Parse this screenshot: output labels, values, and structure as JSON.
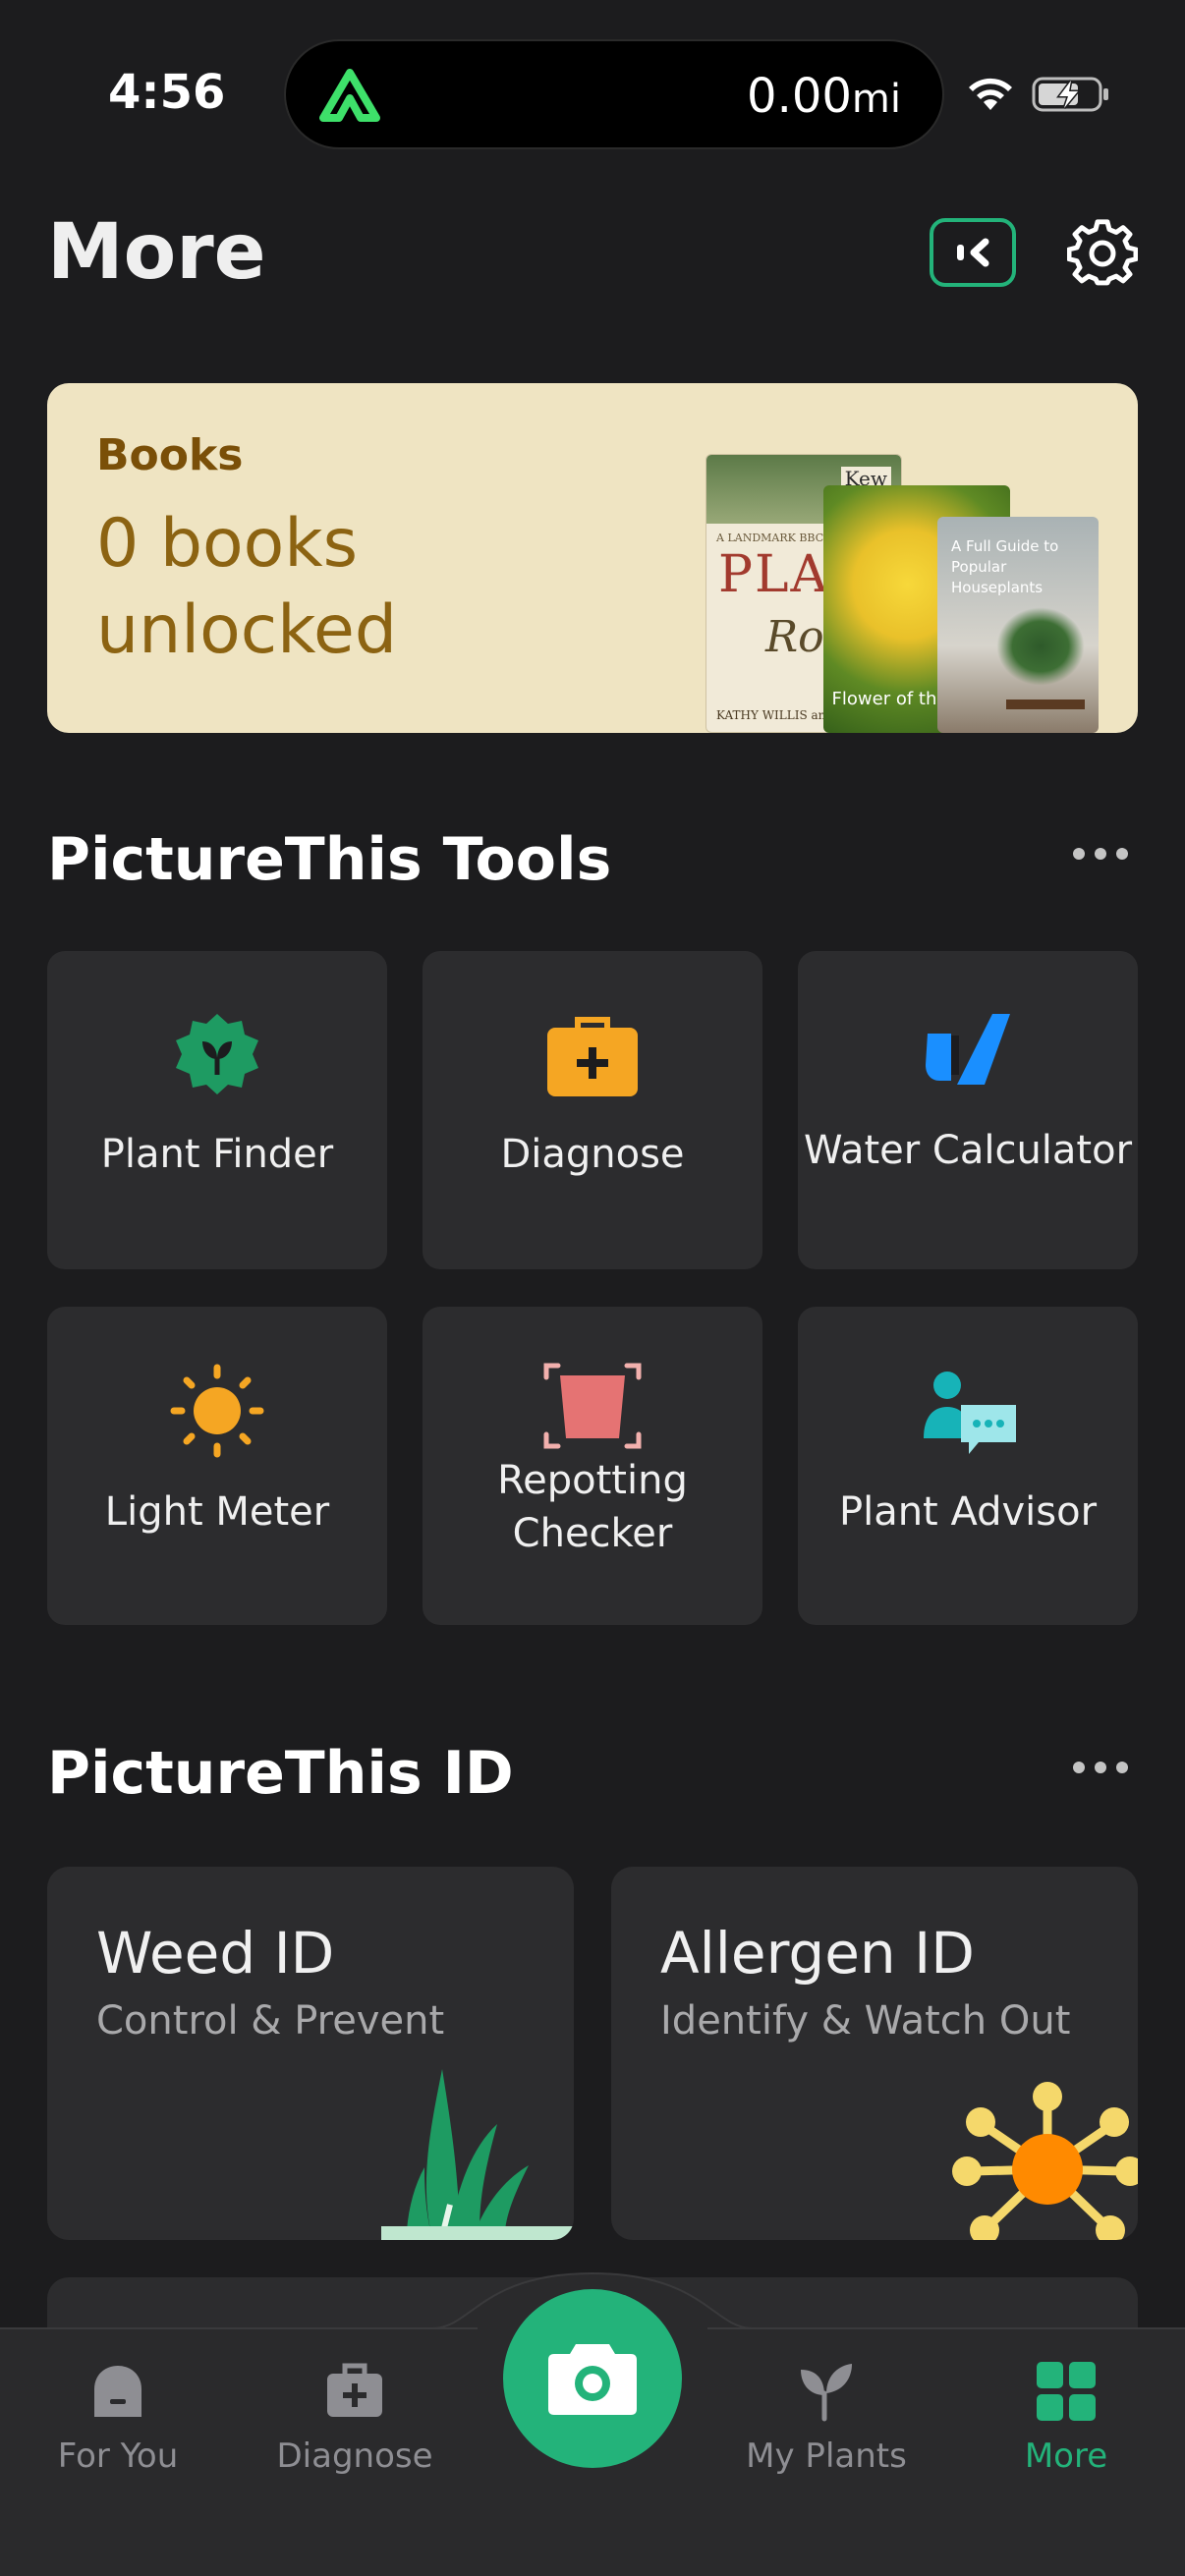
{
  "status_bar": {
    "time": "4:56",
    "activity_distance": "0.00",
    "activity_unit": "mi"
  },
  "header": {
    "title": "More"
  },
  "books": {
    "label": "Books",
    "count_text": "0 books unlocked",
    "covers": {
      "book1_title": "PLANT",
      "book1_script": "Roots",
      "book1_kicker": "A LANDMARK BBC RADIO",
      "book1_author": "KATHY WILLIS and C",
      "book1_publisher": "Kew",
      "book2_text": "Flower of the Week",
      "book3_text": "A Full Guide to Popular Houseplants"
    }
  },
  "tools": {
    "title": "PictureThis Tools",
    "items": [
      {
        "label": "Plant Finder",
        "icon": "plant-finder-icon"
      },
      {
        "label": "Diagnose",
        "icon": "diagnose-kit-icon"
      },
      {
        "label": "Water Calculator",
        "icon": "water-drop-icon"
      },
      {
        "label": "Light Meter",
        "icon": "sun-icon"
      },
      {
        "label": "Repotting Checker",
        "icon": "pot-icon"
      },
      {
        "label": "Plant Advisor",
        "icon": "advisor-chat-icon"
      }
    ]
  },
  "id_section": {
    "title": "PictureThis ID",
    "cards": [
      {
        "title": "Weed ID",
        "subtitle": "Control & Prevent",
        "icon": "weed-grass-icon"
      },
      {
        "title": "Allergen ID",
        "subtitle": "Identify & Watch Out",
        "icon": "pollen-icon"
      }
    ]
  },
  "tabbar": {
    "items": [
      {
        "label": "For You",
        "icon": "home-icon"
      },
      {
        "label": "Diagnose",
        "icon": "medkit-icon"
      },
      {
        "label": "My Plants",
        "icon": "sprout-icon"
      },
      {
        "label": "More",
        "icon": "grid-icon"
      }
    ],
    "active": "More"
  },
  "colors": {
    "accent": "#23b37a",
    "background": "#1c1c1e",
    "tile": "#2c2c2e",
    "books_card": "#efe4c2",
    "books_text": "#8c6312"
  }
}
